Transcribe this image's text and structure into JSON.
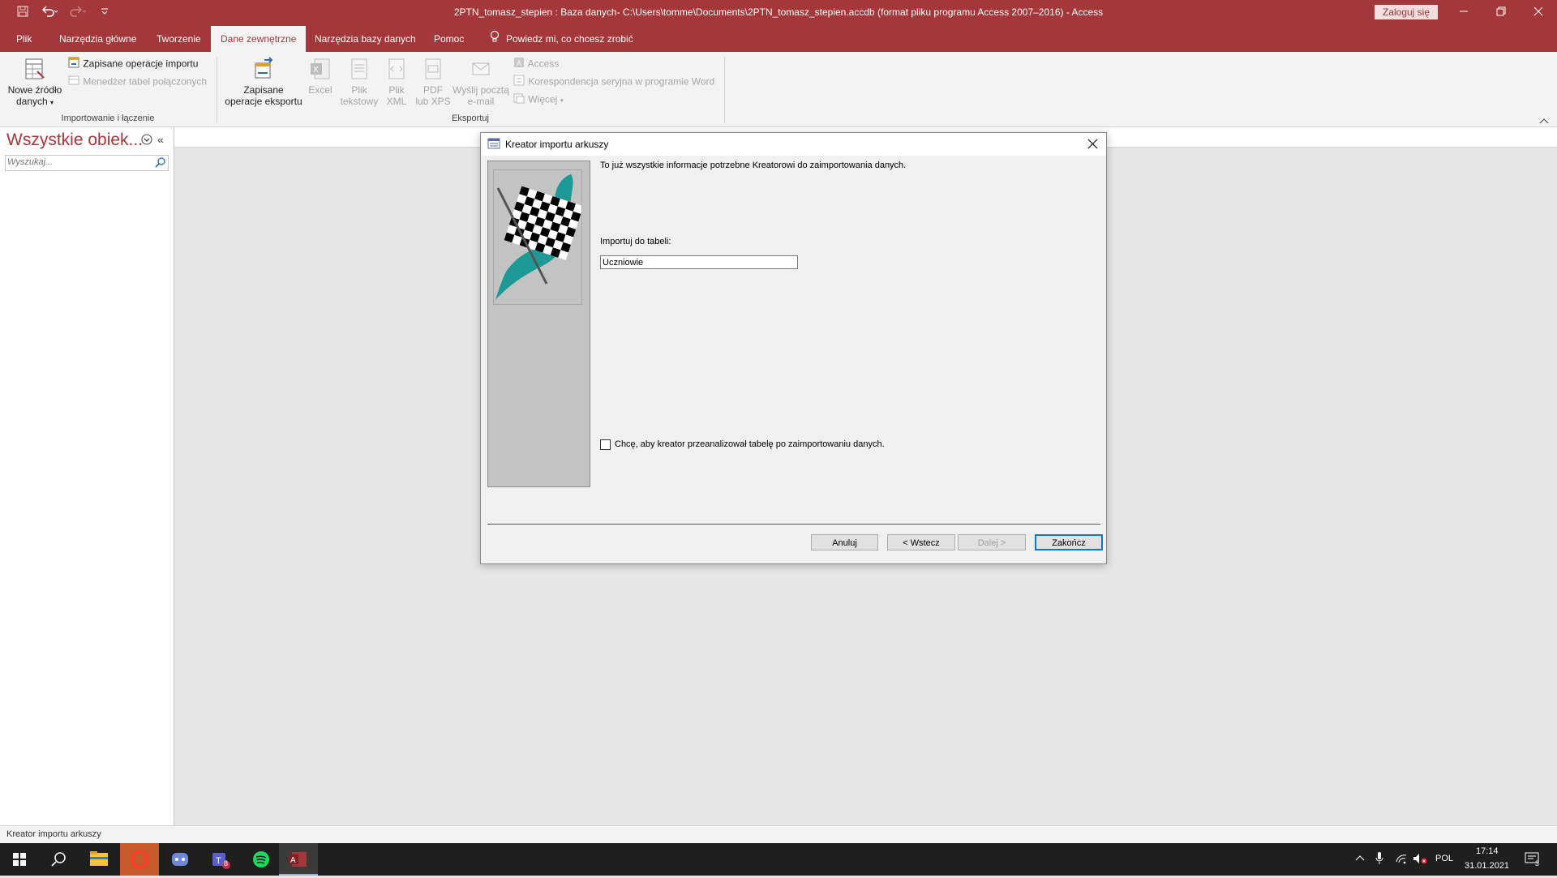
{
  "window": {
    "title": "2PTN_tomasz_stepien : Baza danych- C:\\Users\\tomme\\Documents\\2PTN_tomasz_stepien.accdb (format pliku programu Access 2007–2016)  -  Access",
    "signin_label": "Zaloguj się"
  },
  "tabs": [
    {
      "label": "Plik"
    },
    {
      "label": "Narzędzia główne"
    },
    {
      "label": "Tworzenie"
    },
    {
      "label": "Dane zewnętrzne"
    },
    {
      "label": "Narzędzia bazy danych"
    },
    {
      "label": "Pomoc"
    }
  ],
  "tellme": "Powiedz mi, co chcesz zrobić",
  "ribbon": {
    "import_group": {
      "new_source_line1": "Nowe źródło",
      "new_source_line2": "danych",
      "saved_imports": "Zapisane operacje importu",
      "linked_table_manager": "Menedżer tabel połączonych",
      "label": "Importowanie i łączenie"
    },
    "export_group": {
      "saved_exports_line1": "Zapisane",
      "saved_exports_line2": "operacje eksportu",
      "excel": "Excel",
      "text_line1": "Plik",
      "text_line2": "tekstowy",
      "xml_line1": "Plik",
      "xml_line2": "XML",
      "pdf_line1": "PDF",
      "pdf_line2": "lub XPS",
      "email_line1": "Wyślij pocztą",
      "email_line2": "e-mail",
      "access": "Access",
      "word_merge": "Korespondencja seryjna w programie Word",
      "more": "Więcej",
      "label": "Eksportuj"
    }
  },
  "nav": {
    "title": "Wszystkie obiek...",
    "search_placeholder": "Wyszukaj..."
  },
  "dialog": {
    "title": "Kreator importu arkuszy",
    "intro": "To już wszystkie informacje potrzebne Kreatorowi do zaimportowania danych.",
    "import_label": "Importuj do tabeli:",
    "table_name": "Uczniowie",
    "analyze_checkbox": "Chcę, aby kreator przeanalizował tabelę po zaimportowaniu danych.",
    "analyze_checked": false,
    "buttons": {
      "cancel": "Anuluj",
      "back": "< Wstecz",
      "next": "Dalej >",
      "finish": "Zakończ"
    }
  },
  "status": {
    "text": "Kreator importu arkuszy"
  },
  "taskbar": {
    "language": "POL",
    "time": "17:14",
    "date": "31.01.2021",
    "notifications": "3",
    "teams_badge": "8"
  },
  "colors": {
    "accent": "#a4373a",
    "taskbar": "#1f1f1f",
    "dialog_focus": "#0078d7"
  }
}
